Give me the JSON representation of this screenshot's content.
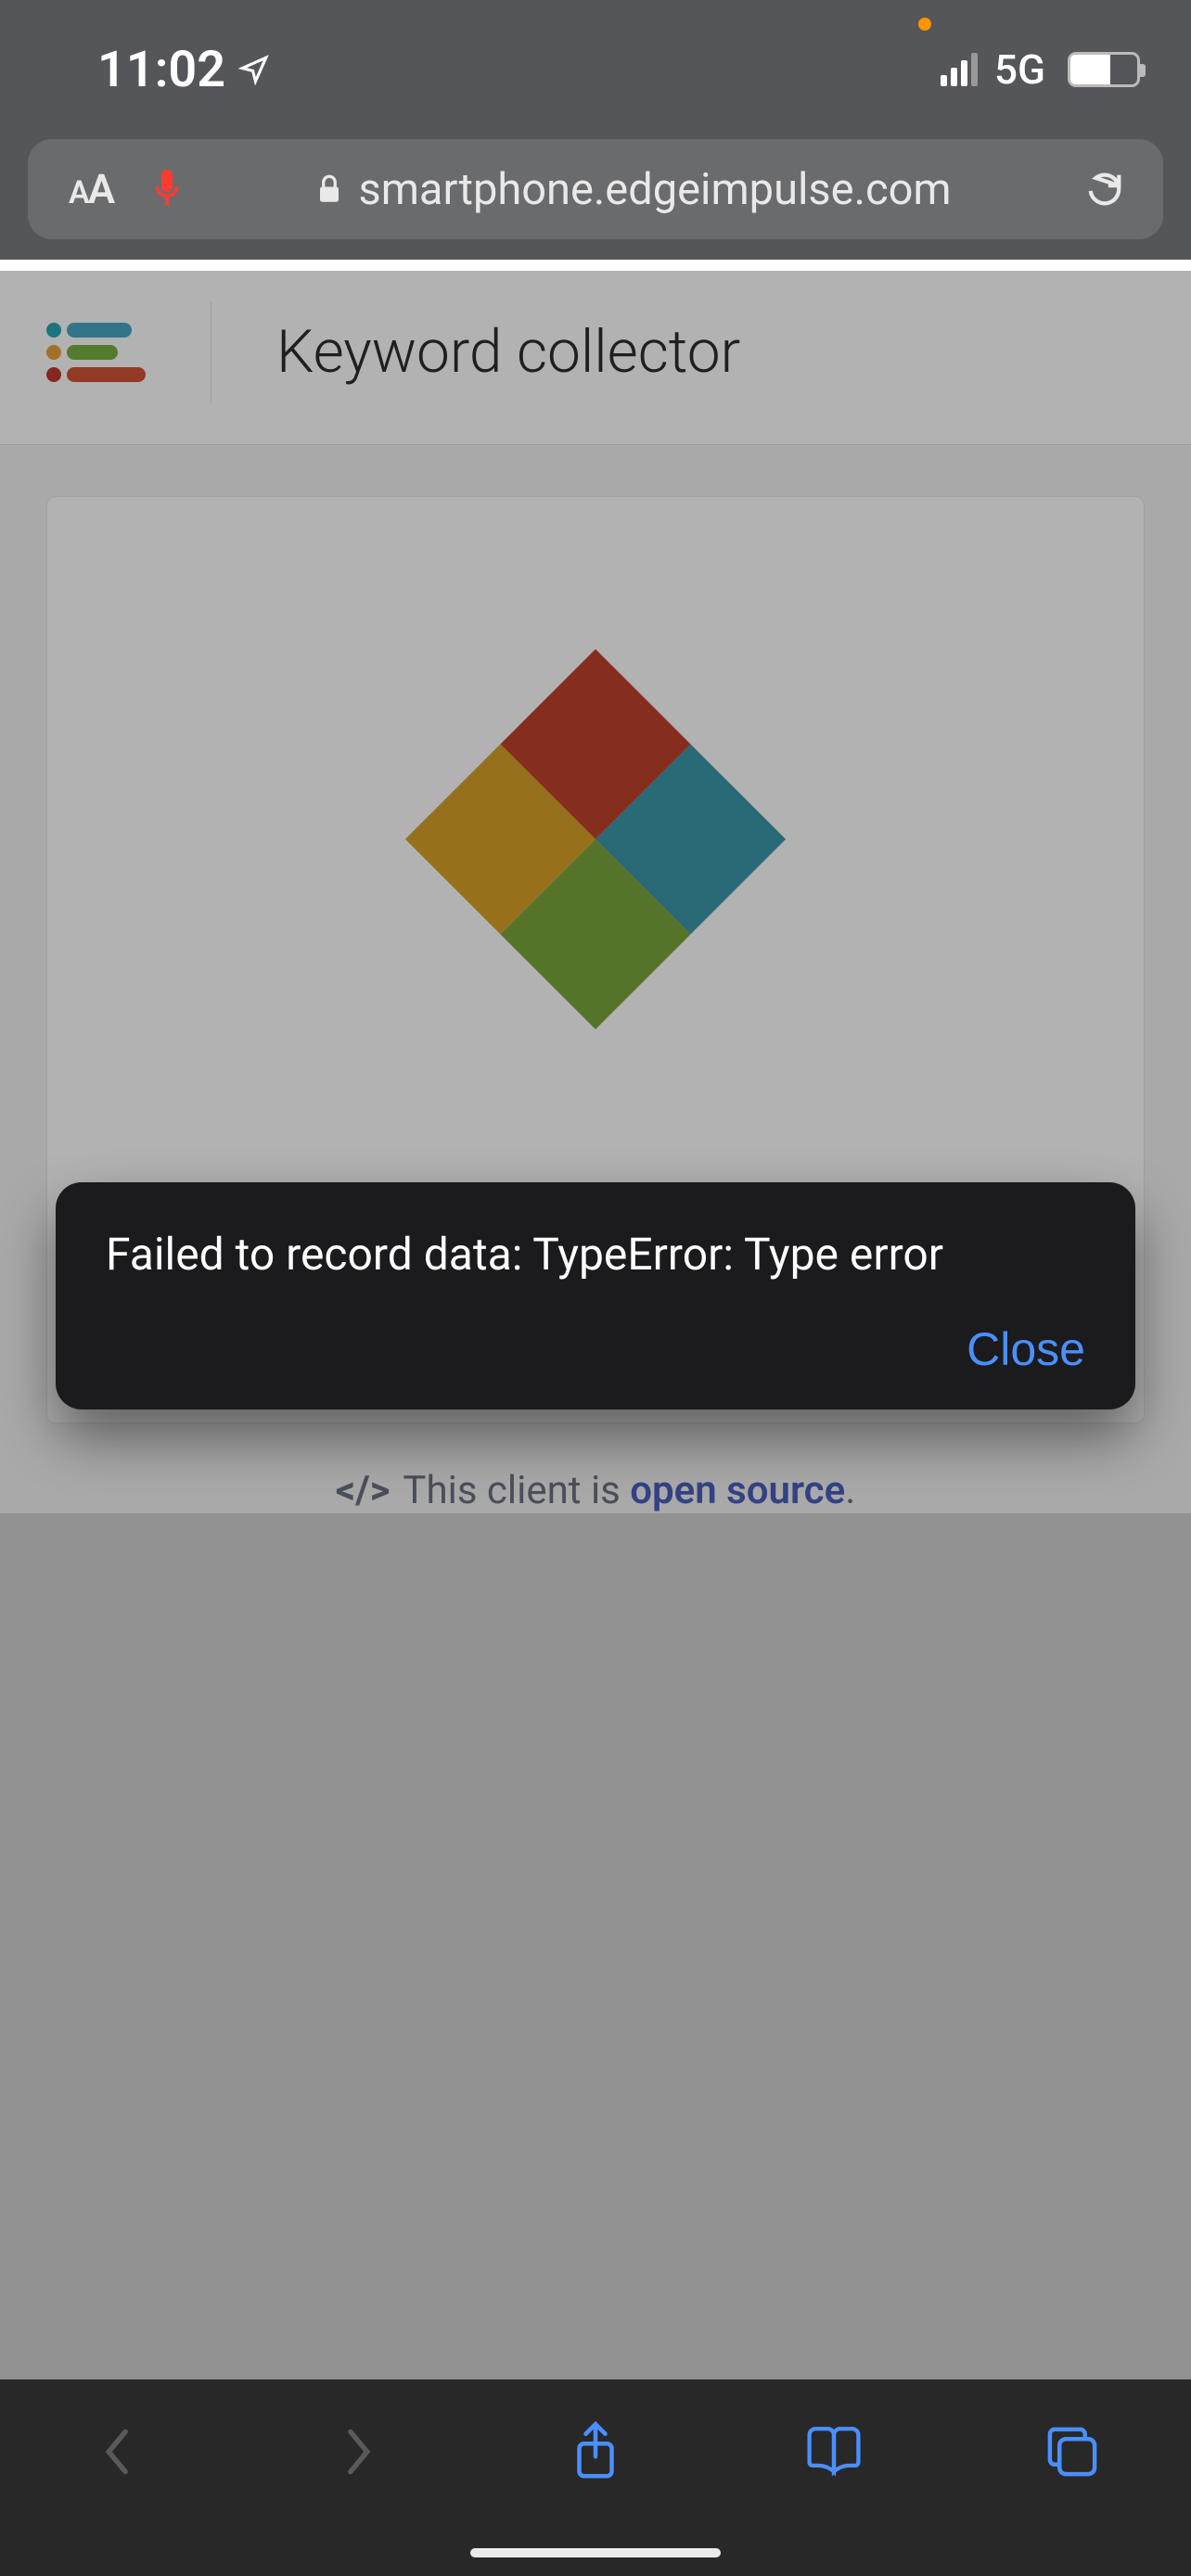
{
  "status": {
    "time": "11:02",
    "network_label": "5G"
  },
  "browser": {
    "text_size_label": "AA",
    "url": "smartphone.edgeimpulse.com"
  },
  "app": {
    "title": "Keyword collector"
  },
  "footer": {
    "prefix": "This client is ",
    "link_text": "open source",
    "suffix": "."
  },
  "alert": {
    "message": "Failed to record data: TypeError: Type error",
    "close_label": "Close"
  }
}
